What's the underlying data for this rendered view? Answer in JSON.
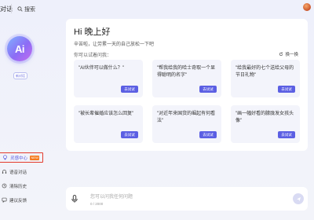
{
  "topbar": {
    "app_title": "对话",
    "search_label": "搜索"
  },
  "sidebar": {
    "logo_text": "Ai",
    "new_chat_label": "新对话",
    "items": [
      {
        "label": "灵感中心",
        "badge": "NEW",
        "icon": "bulb-icon",
        "active": true
      },
      {
        "label": "语音对话",
        "icon": "headset-icon"
      },
      {
        "label": "清除历史",
        "icon": "clear-history-icon"
      },
      {
        "label": "建议反馈",
        "icon": "feedback-icon"
      }
    ]
  },
  "main": {
    "greeting": "Hi 晚上好",
    "sub_greeting": "辛苦啦，让劳累一天的自己放松一下吧",
    "ask_label": "你可以试着问我：",
    "refresh_label": "换一换",
    "suggestions": [
      {
        "text": "\"AI伙伴可以做什么？\"",
        "button": "去试试"
      },
      {
        "text": "\"帮我给我的哈士奇取一个显得聪明的名字\"",
        "button": "去试试"
      },
      {
        "text": "\"给我最好的七个送给父母的节日礼物\"",
        "button": "去试试"
      },
      {
        "text": "\"被长辈催婚应该怎么回复\"",
        "button": "去试试"
      },
      {
        "text": "\"对近年来国货的崛起有何看法\"",
        "button": "去试试"
      },
      {
        "text": "\"画一幅好看的朦胧发女孩头像\"",
        "button": "去试试"
      }
    ]
  },
  "input": {
    "placeholder": "您可以问我任何问题",
    "counter": "0 / 2000"
  },
  "colors": {
    "accent": "#5b5fe3",
    "badge": "#f57c1f",
    "highlight_border": "#e33a2c"
  }
}
